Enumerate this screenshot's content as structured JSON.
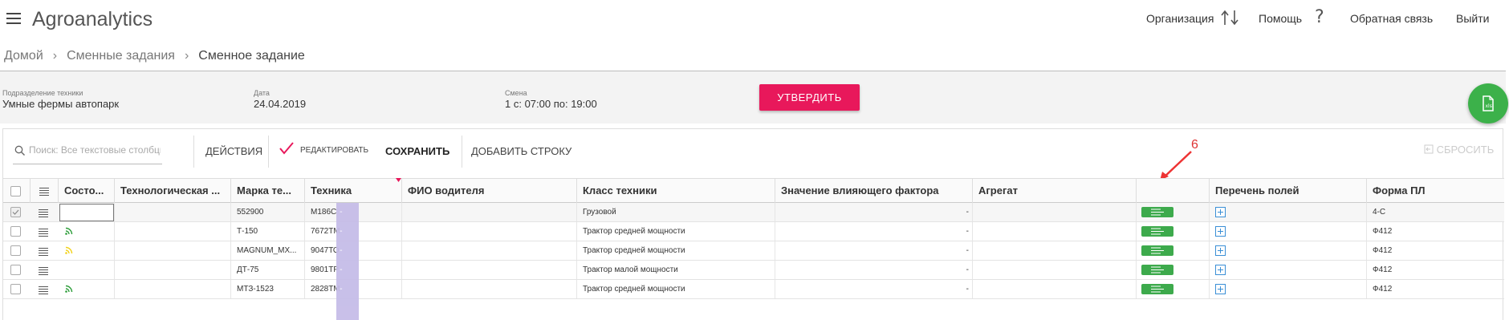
{
  "header": {
    "app_title": "Agroanalytics",
    "links": {
      "organization": "Организация",
      "help": "Помощь",
      "feedback": "Обратная связь",
      "logout": "Выйти"
    }
  },
  "breadcrumb": {
    "items": [
      "Домой",
      "Сменные задания",
      "Сменное задание"
    ]
  },
  "info": {
    "division_label": "Подразделение техники",
    "division_value": "Умные фермы автопарк",
    "date_label": "Дата",
    "date_value": "24.04.2019",
    "shift_label": "Смена",
    "shift_value": "1 с: 07:00 по: 19:00",
    "approve_label": "УТВЕРДИТЬ"
  },
  "toolbar": {
    "search_placeholder": "Поиск: Все текстовые столбцы",
    "actions": "ДЕЙСТВИЯ",
    "edit": "РЕДАКТИРОВАТЬ",
    "save": "СОХРАНИТЬ",
    "add_row": "ДОБАВИТЬ СТРОКУ",
    "reset": "СБРОСИТЬ"
  },
  "annotation": {
    "number": "6"
  },
  "table": {
    "columns": [
      "Состо...",
      "Технологическая ...",
      "Марка те...",
      "Техника",
      "ФИО водителя",
      "Класс техники",
      "Значение влияющего фактора",
      "Агрегат",
      "",
      "Перечень полей",
      "Форма ПЛ"
    ],
    "rows": [
      {
        "status": "",
        "brand": "552900",
        "tech": "М186С",
        "driver": "",
        "klass": "Грузовой",
        "factor": "-",
        "form": "4-С"
      },
      {
        "status": "green",
        "brand": "Т-150",
        "tech": "7672ТМ",
        "driver": "",
        "klass": "Трактор средней мощности",
        "factor": "-",
        "form": "Ф412"
      },
      {
        "status": "yellow",
        "brand": "MAGNUM_MX...",
        "tech": "9047ТО",
        "driver": "",
        "klass": "Трактор средней мощности",
        "factor": "-",
        "form": "Ф412"
      },
      {
        "status": "",
        "brand": "ДТ-75",
        "tech": "9801ТР",
        "driver": "",
        "klass": "Трактор малой мощности",
        "factor": "-",
        "form": "Ф412"
      },
      {
        "status": "green",
        "brand": "МТЗ-1523",
        "tech": "2828ТМ",
        "driver": "",
        "klass": "Трактор средней мощности",
        "factor": "-",
        "form": "Ф412"
      }
    ]
  },
  "colors": {
    "approve": "#e8185b",
    "fab": "#3cb14a",
    "status_green": "#2e9e3b",
    "status_yellow": "#f2d21b",
    "tech_highlight": "#c6bde8"
  }
}
